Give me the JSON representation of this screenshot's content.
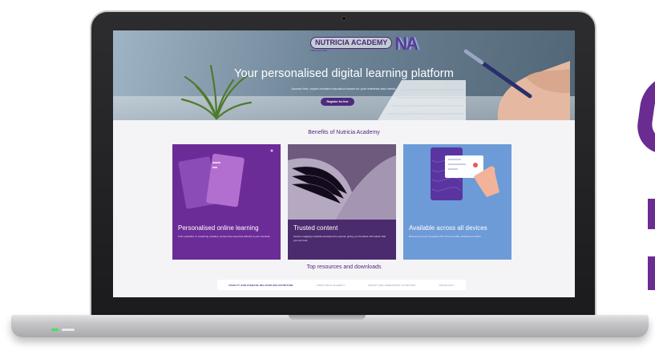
{
  "brand": {
    "logo_text": "NUTRICIA ACADEMY",
    "logo_mark": "NA",
    "logo_tag": "Feed your mind"
  },
  "hero": {
    "title": "Your personalised digital learning platform",
    "subtitle": "Access free, expert-created education based on your interests and needs.",
    "register_label": "Register for free"
  },
  "benefits": {
    "title": "Benefits of Nutricia Academy",
    "cards": [
      {
        "title": "Personalised online learning",
        "text": "From podcasts, to e-learning modules, access free resources tailored to your interests."
      },
      {
        "title": "Trusted content",
        "text": "Access engaging materials developed by experts, giving you the latest information that you can trust."
      },
      {
        "title": "Available across all devices",
        "text": "Resources at your fingertips 24/7 across mobile, desktop and tablet."
      }
    ]
  },
  "resources": {
    "title": "Top resources and downloads",
    "tabs": [
      "FRAILTY AND DISEASE RELATED MALNUTRITION",
      "COW'S MILK ALLERGY",
      "INFANT AND PAEDIATRIC NUTRITION",
      "ONCOLOGY"
    ]
  },
  "colors": {
    "accent": "#4d2a7c",
    "card_purple": "#6c2c98",
    "card_dark_purple": "#4b2b6e",
    "card_blue": "#6d9bd8",
    "led_green": "#42e15a"
  }
}
